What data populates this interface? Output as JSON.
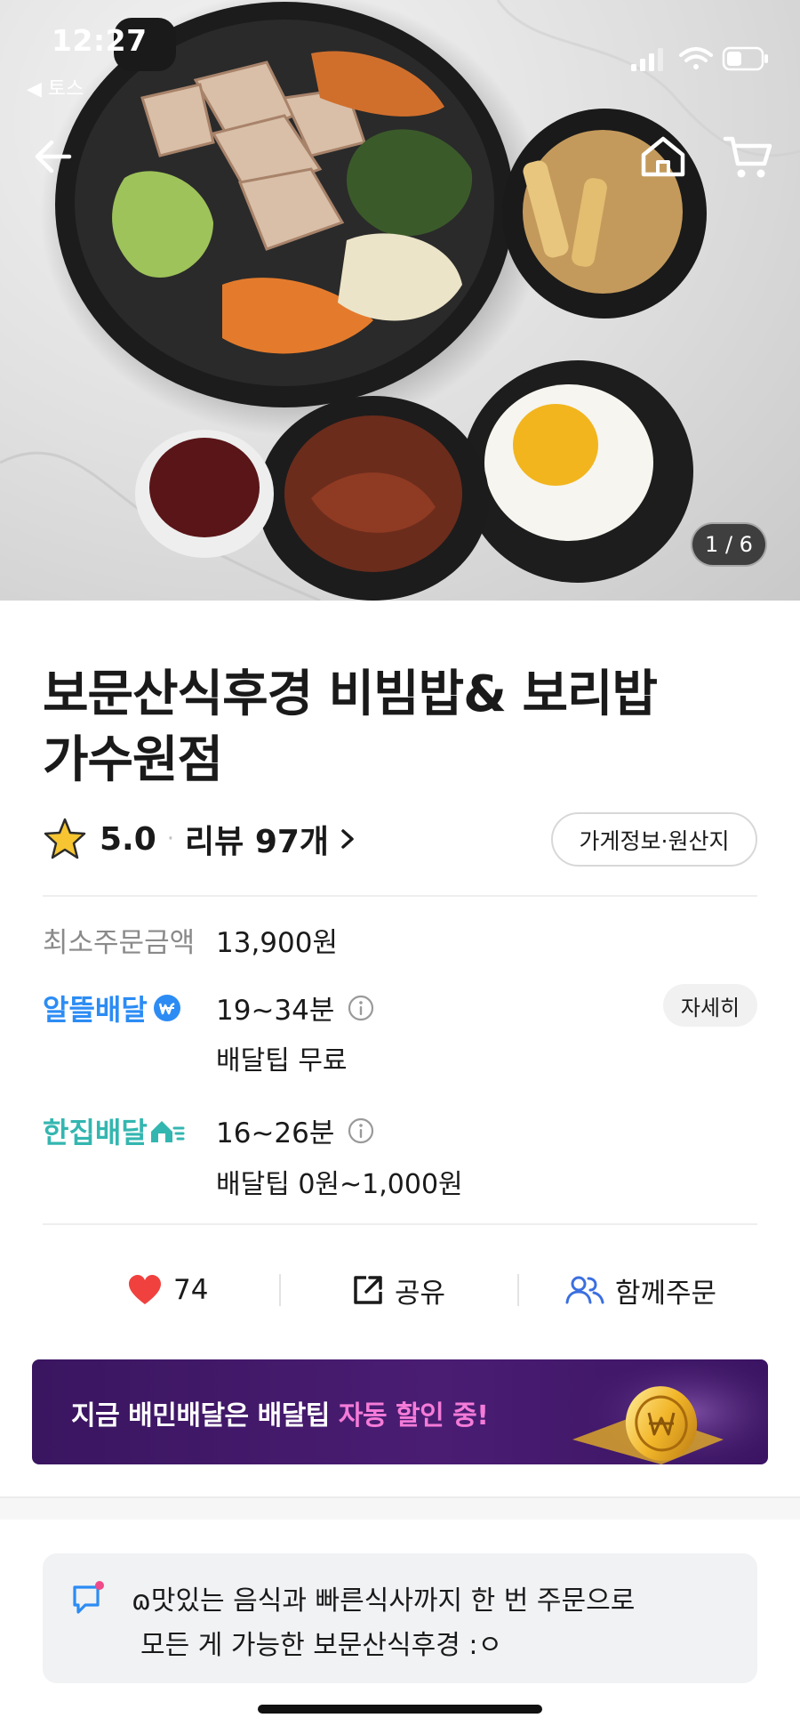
{
  "status_bar": {
    "time": "12:27",
    "back_app": "◀ 토스"
  },
  "hero": {
    "photo_counter": "1 / 6",
    "nav_icons": [
      "arrow-left-icon",
      "home-icon",
      "cart-icon"
    ]
  },
  "store": {
    "title": "보문산식후경 비빔밥& 보리밥 가수원점",
    "rating": "5.0",
    "rating_separator": "·",
    "reviews": "리뷰 97개",
    "info_button": "가게정보·원산지"
  },
  "order_info": {
    "min_order_label": "최소주문금액",
    "min_order_value": "13,900원",
    "albdl": {
      "label": "알뜰배달",
      "time": "19~34분",
      "tip": "배달팁 무료",
      "detail_button": "자세히"
    },
    "hanjip": {
      "label": "한집배달",
      "time": "16~26분",
      "tip": "배달팁 0원~1,000원"
    }
  },
  "actions": {
    "like_count": "74",
    "share": "공유",
    "group_order": "함께주문"
  },
  "banner": {
    "text_main": "지금 배민배달은 배달팁 ",
    "text_highlight": "자동 할인 중!"
  },
  "notice": {
    "line1": "ɷ맛있는 음식과 빠른식사까지 한 번 주문으로",
    "line2": "모든 게 가능한 보문산식후경 :ㅇ"
  },
  "colors": {
    "albdl_blue": "#2c8cf4",
    "hanjip_teal": "#34b6b0",
    "banner_purple": "#4a1d73",
    "banner_highlight": "#f57bd8",
    "heart_red": "#f0413f",
    "group_icon_blue": "#3b6fe0"
  }
}
